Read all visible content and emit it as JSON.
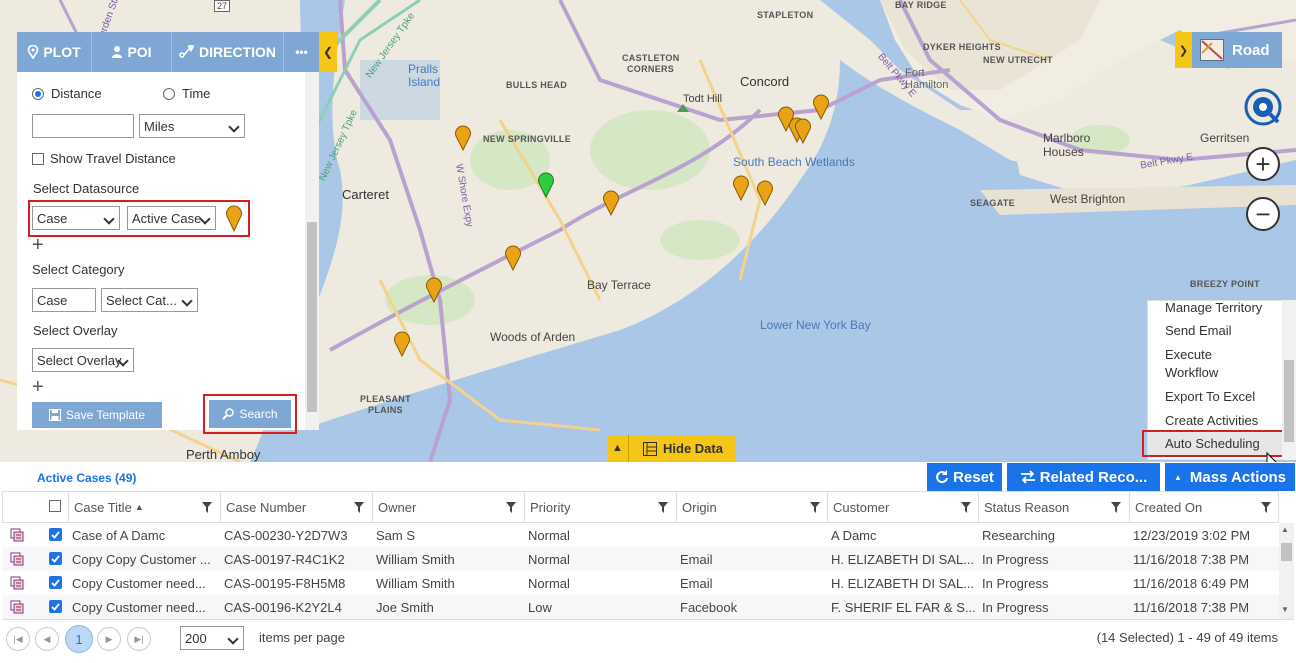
{
  "toolbar": {
    "plot_label": "PLOT",
    "poi_label": "POI",
    "direction_label": "DIRECTION",
    "more_label": "•••"
  },
  "panel": {
    "distance_label": "Distance",
    "time_label": "Time",
    "distance_value": "",
    "unit_value": "Miles",
    "show_travel_distance_label": "Show Travel Distance",
    "select_datasource_label": "Select Datasource",
    "datasource_entity": "Case",
    "datasource_view": "Active Case",
    "select_category_label": "Select Category",
    "category_entity": "Case",
    "category_value": "Select Cat...",
    "select_overlay_label": "Select Overlay",
    "overlay_value": "Select Overlay",
    "save_template_label": "Save Template",
    "search_label": "Search"
  },
  "map": {
    "road_label": "Road",
    "zoom_in": "+",
    "zoom_out": "−",
    "hide_data_label": "Hide Data",
    "labels": {
      "stapleton": "STAPLETON",
      "bay_ridge": "BAY RIDGE",
      "castleton": "CASTLETON",
      "corners": "CORNERS",
      "dyker": "DYKER HEIGHTS",
      "new_utrecht": "NEW UTRECHT",
      "fort_hamilton": "Fort\nHamilton",
      "concord": "Concord",
      "bulls_head": "BULLS HEAD",
      "todt_hill": "Todt Hill",
      "pralls": "Pralls\nIsland",
      "new_springville": "NEW SPRINGVILLE",
      "south_beach": "South Beach Wetlands",
      "marlboro": "Marlboro\nHouses",
      "gerritsen": "Gerritsen",
      "carteret": "Carteret",
      "seagate": "SEAGATE",
      "west_brighton": "West Brighton",
      "bay_terrace": "Bay Terrace",
      "lower_ny_bay": "Lower New York Bay",
      "breezy_point": "BREEZY POINT",
      "woods_of_arden": "Woods of Arden",
      "pleasant_plains": "PLEASANT\nPLAINS",
      "perth_amboy": "Perth Amboy",
      "hwy_27": "27",
      "nj_tpke": "New Jersey Tpke",
      "nj_tpke2": "New Jersey Tpke",
      "belt_pkwy": "Belt Pkwy E",
      "belt_pkwy2": "Belt Pkwy E",
      "garden_state": "Garden State",
      "ws_expy": "W Shore Expy"
    }
  },
  "context_menu": {
    "items": [
      "Manage Territory",
      "Send Email",
      "Execute\nWorkflow",
      "Export To Excel",
      "Create Activities",
      "Auto Scheduling"
    ]
  },
  "grid": {
    "title": "Active Cases (49)",
    "reset_label": "Reset",
    "related_label": "Related Reco...",
    "mass_actions_label": "Mass Actions",
    "columns": [
      "Case Title",
      "Case Number",
      "Owner",
      "Priority",
      "Origin",
      "Customer",
      "Status Reason",
      "Created On"
    ],
    "sort_indicator": "▲",
    "rows": [
      [
        "Case of A Damc",
        "CAS-00230-Y2D7W3",
        "Sam S",
        "Normal",
        "",
        "A Damc",
        "Researching",
        "12/23/2019 3:02 PM"
      ],
      [
        "Copy Copy Customer ...",
        "CAS-00197-R4C1K2",
        "William Smith",
        "Normal",
        "Email",
        "H. ELIZABETH DI SAL...",
        "In Progress",
        "11/16/2018 7:38 PM"
      ],
      [
        "Copy Customer need...",
        "CAS-00195-F8H5M8",
        "William Smith",
        "Normal",
        "Email",
        "H. ELIZABETH DI SAL...",
        "In Progress",
        "11/16/2018 6:49 PM"
      ],
      [
        "Copy Customer need...",
        "CAS-00196-K2Y2L4",
        "Joe Smith",
        "Low",
        "Facebook",
        "F. SHERIF EL FAR & S...",
        "In Progress",
        "11/16/2018 7:38 PM"
      ]
    ],
    "page_number": "1",
    "page_size": "200",
    "items_per_page_label": "items per page",
    "summary": "(14 Selected) 1 - 49 of 49 items"
  },
  "colors": {
    "toolbar_blue": "#7fa7d4",
    "accent_yellow": "#f5c518",
    "grid_blue": "#1a73e8",
    "highlight_red": "#d71e1e",
    "pin_orange": "#e8a317",
    "pin_green": "#2ecc40",
    "water": "#aac7e8"
  }
}
